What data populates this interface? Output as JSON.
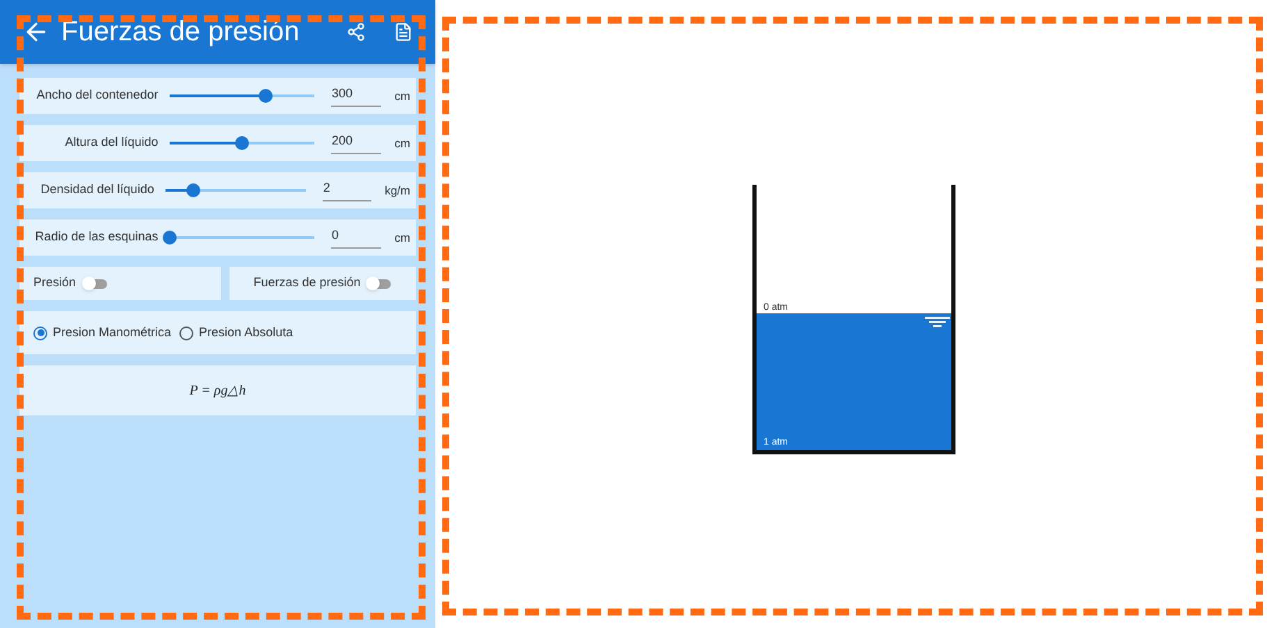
{
  "header": {
    "title": "Fuerzas de presión"
  },
  "sliders": [
    {
      "label": "Ancho del contenedor",
      "level": 0.66,
      "value": "300",
      "unit": "cm"
    },
    {
      "label": "Altura del líquido",
      "level": 0.5,
      "value": "200",
      "unit": "cm"
    },
    {
      "label": "Densidad del líquido",
      "level": 0.2,
      "value": "2",
      "unit": "kg/m"
    },
    {
      "label": "Radio de las esquinas",
      "level": 0,
      "value": "0",
      "unit": "cm"
    }
  ],
  "toggles": [
    {
      "label": "Presión",
      "on": false
    },
    {
      "label": "Fuerzas de presión",
      "on": false
    }
  ],
  "pressure_modes": [
    {
      "label": "Presion Manométrica",
      "selected": true
    },
    {
      "label": "Presion Absoluta",
      "selected": false
    }
  ],
  "formula": "P = ρg△h",
  "tank": {
    "top_label": "0 atm",
    "bottom_label": "1 atm",
    "level": 0.52
  }
}
